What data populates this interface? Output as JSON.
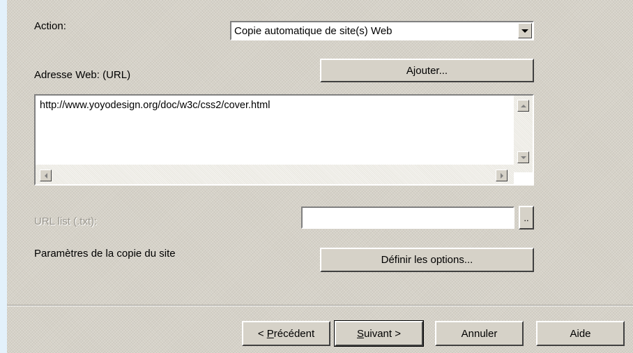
{
  "action": {
    "label": "Action:",
    "selected": "Copie automatique de site(s) Web"
  },
  "url_section": {
    "label": "Adresse Web: (URL)",
    "add_button": "Ajouter...",
    "url_text": "http://www.yoyodesign.org/doc/w3c/css2/cover.html"
  },
  "url_list": {
    "label": "URL list (.txt):",
    "value": "",
    "browse_button": ".."
  },
  "copy_params": {
    "label": "Paramètres de la copie du site",
    "options_button": "Définir les options..."
  },
  "footer": {
    "prev_mnemonic": "P",
    "prev_rest": "récédent",
    "prev_prefix": "< ",
    "next_mnemonic": "S",
    "next_rest": "uivant >",
    "cancel": "Annuler",
    "help": "Aide"
  },
  "colors": {
    "background": "#e3f1fb",
    "panel": "#d6d2c8",
    "disabled_text": "#9a978f"
  },
  "icons": [
    "scroll-up-icon",
    "scroll-down-icon",
    "scroll-left-icon",
    "scroll-right-icon",
    "dropdown-arrow-icon"
  ]
}
